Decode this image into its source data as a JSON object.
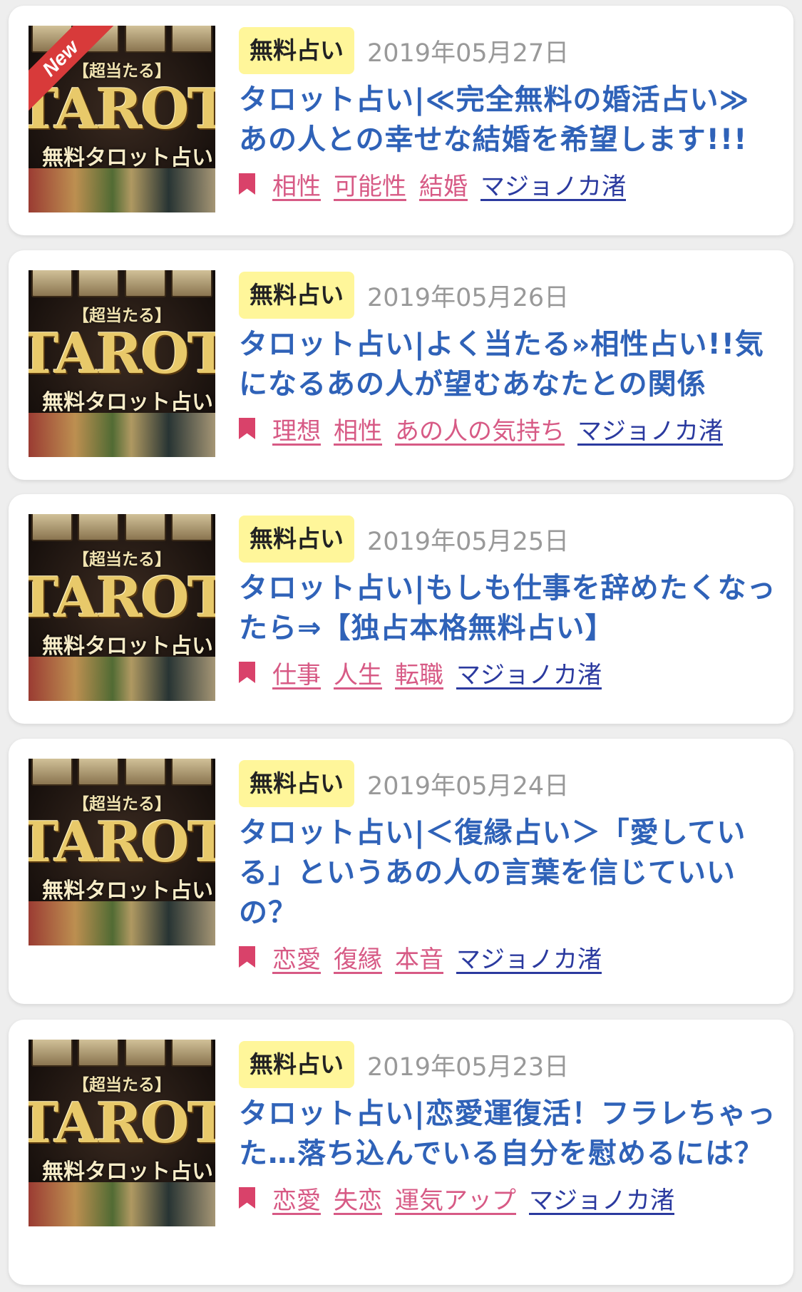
{
  "posts": [
    {
      "category": "無料占い",
      "date": "2019年05月27日",
      "title": "タロット占い|≪完全無料の婚活占い≫あの人との幸せな結婚を希望します!!!",
      "tags": [
        "相性",
        "可能性",
        "結婚"
      ],
      "author": "マジョノカ渚",
      "is_new": true,
      "new_label": "New"
    },
    {
      "category": "無料占い",
      "date": "2019年05月26日",
      "title": "タロット占い|よく当たる»相性占い!!気になるあの人が望むあなたとの関係",
      "tags": [
        "理想",
        "相性",
        "あの人の気持ち"
      ],
      "author": "マジョノカ渚",
      "is_new": false
    },
    {
      "category": "無料占い",
      "date": "2019年05月25日",
      "title": "タロット占い|もしも仕事を辞めたくなったら⇒【独占本格無料占い】",
      "tags": [
        "仕事",
        "人生",
        "転職"
      ],
      "author": "マジョノカ渚",
      "is_new": false
    },
    {
      "category": "無料占い",
      "date": "2019年05月24日",
      "title": "タロット占い|＜復縁占い＞「愛している」というあの人の言葉を信じていいの？",
      "tags": [
        "恋愛",
        "復縁",
        "本音"
      ],
      "author": "マジョノカ渚",
      "is_new": false
    },
    {
      "category": "無料占い",
      "date": "2019年05月23日",
      "title": "タロット占い|恋愛運復活！フラレちゃった…落ち込んでいる自分を慰めるには？",
      "tags": [
        "恋愛",
        "失恋",
        "運気アップ"
      ],
      "author": "マジョノカ渚",
      "is_new": false
    }
  ],
  "thumbnail": {
    "line1": "【超当たる】",
    "line2": "TAROT",
    "line3": "無料タロット占い"
  },
  "colors": {
    "category_bg": "#fff69a",
    "title": "#2f62b8",
    "tag": "#d75a85",
    "author": "#2b3a9f",
    "bookmark": "#d9426a",
    "new_ribbon": "#d83a3a"
  },
  "icons": {
    "tag_icon": "bookmark-icon"
  }
}
